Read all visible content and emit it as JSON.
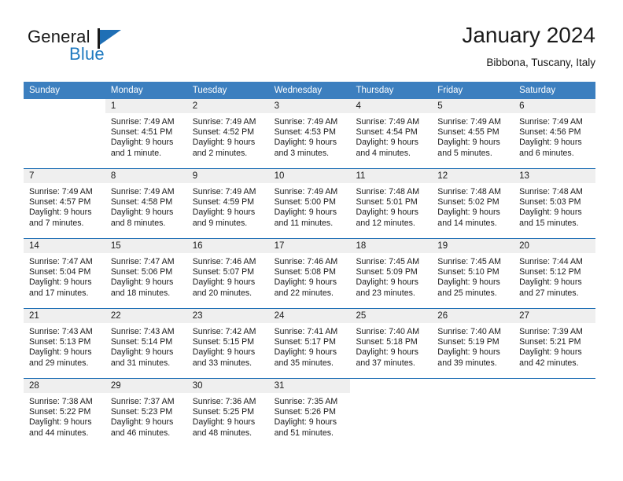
{
  "brand": {
    "name_part1": "General",
    "name_part2": "Blue"
  },
  "header": {
    "title": "January 2024",
    "location": "Bibbona, Tuscany, Italy"
  },
  "weekdays": [
    "Sunday",
    "Monday",
    "Tuesday",
    "Wednesday",
    "Thursday",
    "Friday",
    "Saturday"
  ],
  "colors": {
    "header_blue": "#3c7fbf",
    "week_rule_blue": "#1f6fb5",
    "daynum_band": "#efefef",
    "logo_blue": "#1f7ac0",
    "text": "#1a1a1a"
  },
  "weeks": [
    [
      {
        "day": "",
        "sunrise": "",
        "sunset": "",
        "daylight_line1": "",
        "daylight_line2": ""
      },
      {
        "day": "1",
        "sunrise": "Sunrise: 7:49 AM",
        "sunset": "Sunset: 4:51 PM",
        "daylight_line1": "Daylight: 9 hours",
        "daylight_line2": "and 1 minute."
      },
      {
        "day": "2",
        "sunrise": "Sunrise: 7:49 AM",
        "sunset": "Sunset: 4:52 PM",
        "daylight_line1": "Daylight: 9 hours",
        "daylight_line2": "and 2 minutes."
      },
      {
        "day": "3",
        "sunrise": "Sunrise: 7:49 AM",
        "sunset": "Sunset: 4:53 PM",
        "daylight_line1": "Daylight: 9 hours",
        "daylight_line2": "and 3 minutes."
      },
      {
        "day": "4",
        "sunrise": "Sunrise: 7:49 AM",
        "sunset": "Sunset: 4:54 PM",
        "daylight_line1": "Daylight: 9 hours",
        "daylight_line2": "and 4 minutes."
      },
      {
        "day": "5",
        "sunrise": "Sunrise: 7:49 AM",
        "sunset": "Sunset: 4:55 PM",
        "daylight_line1": "Daylight: 9 hours",
        "daylight_line2": "and 5 minutes."
      },
      {
        "day": "6",
        "sunrise": "Sunrise: 7:49 AM",
        "sunset": "Sunset: 4:56 PM",
        "daylight_line1": "Daylight: 9 hours",
        "daylight_line2": "and 6 minutes."
      }
    ],
    [
      {
        "day": "7",
        "sunrise": "Sunrise: 7:49 AM",
        "sunset": "Sunset: 4:57 PM",
        "daylight_line1": "Daylight: 9 hours",
        "daylight_line2": "and 7 minutes."
      },
      {
        "day": "8",
        "sunrise": "Sunrise: 7:49 AM",
        "sunset": "Sunset: 4:58 PM",
        "daylight_line1": "Daylight: 9 hours",
        "daylight_line2": "and 8 minutes."
      },
      {
        "day": "9",
        "sunrise": "Sunrise: 7:49 AM",
        "sunset": "Sunset: 4:59 PM",
        "daylight_line1": "Daylight: 9 hours",
        "daylight_line2": "and 9 minutes."
      },
      {
        "day": "10",
        "sunrise": "Sunrise: 7:49 AM",
        "sunset": "Sunset: 5:00 PM",
        "daylight_line1": "Daylight: 9 hours",
        "daylight_line2": "and 11 minutes."
      },
      {
        "day": "11",
        "sunrise": "Sunrise: 7:48 AM",
        "sunset": "Sunset: 5:01 PM",
        "daylight_line1": "Daylight: 9 hours",
        "daylight_line2": "and 12 minutes."
      },
      {
        "day": "12",
        "sunrise": "Sunrise: 7:48 AM",
        "sunset": "Sunset: 5:02 PM",
        "daylight_line1": "Daylight: 9 hours",
        "daylight_line2": "and 14 minutes."
      },
      {
        "day": "13",
        "sunrise": "Sunrise: 7:48 AM",
        "sunset": "Sunset: 5:03 PM",
        "daylight_line1": "Daylight: 9 hours",
        "daylight_line2": "and 15 minutes."
      }
    ],
    [
      {
        "day": "14",
        "sunrise": "Sunrise: 7:47 AM",
        "sunset": "Sunset: 5:04 PM",
        "daylight_line1": "Daylight: 9 hours",
        "daylight_line2": "and 17 minutes."
      },
      {
        "day": "15",
        "sunrise": "Sunrise: 7:47 AM",
        "sunset": "Sunset: 5:06 PM",
        "daylight_line1": "Daylight: 9 hours",
        "daylight_line2": "and 18 minutes."
      },
      {
        "day": "16",
        "sunrise": "Sunrise: 7:46 AM",
        "sunset": "Sunset: 5:07 PM",
        "daylight_line1": "Daylight: 9 hours",
        "daylight_line2": "and 20 minutes."
      },
      {
        "day": "17",
        "sunrise": "Sunrise: 7:46 AM",
        "sunset": "Sunset: 5:08 PM",
        "daylight_line1": "Daylight: 9 hours",
        "daylight_line2": "and 22 minutes."
      },
      {
        "day": "18",
        "sunrise": "Sunrise: 7:45 AM",
        "sunset": "Sunset: 5:09 PM",
        "daylight_line1": "Daylight: 9 hours",
        "daylight_line2": "and 23 minutes."
      },
      {
        "day": "19",
        "sunrise": "Sunrise: 7:45 AM",
        "sunset": "Sunset: 5:10 PM",
        "daylight_line1": "Daylight: 9 hours",
        "daylight_line2": "and 25 minutes."
      },
      {
        "day": "20",
        "sunrise": "Sunrise: 7:44 AM",
        "sunset": "Sunset: 5:12 PM",
        "daylight_line1": "Daylight: 9 hours",
        "daylight_line2": "and 27 minutes."
      }
    ],
    [
      {
        "day": "21",
        "sunrise": "Sunrise: 7:43 AM",
        "sunset": "Sunset: 5:13 PM",
        "daylight_line1": "Daylight: 9 hours",
        "daylight_line2": "and 29 minutes."
      },
      {
        "day": "22",
        "sunrise": "Sunrise: 7:43 AM",
        "sunset": "Sunset: 5:14 PM",
        "daylight_line1": "Daylight: 9 hours",
        "daylight_line2": "and 31 minutes."
      },
      {
        "day": "23",
        "sunrise": "Sunrise: 7:42 AM",
        "sunset": "Sunset: 5:15 PM",
        "daylight_line1": "Daylight: 9 hours",
        "daylight_line2": "and 33 minutes."
      },
      {
        "day": "24",
        "sunrise": "Sunrise: 7:41 AM",
        "sunset": "Sunset: 5:17 PM",
        "daylight_line1": "Daylight: 9 hours",
        "daylight_line2": "and 35 minutes."
      },
      {
        "day": "25",
        "sunrise": "Sunrise: 7:40 AM",
        "sunset": "Sunset: 5:18 PM",
        "daylight_line1": "Daylight: 9 hours",
        "daylight_line2": "and 37 minutes."
      },
      {
        "day": "26",
        "sunrise": "Sunrise: 7:40 AM",
        "sunset": "Sunset: 5:19 PM",
        "daylight_line1": "Daylight: 9 hours",
        "daylight_line2": "and 39 minutes."
      },
      {
        "day": "27",
        "sunrise": "Sunrise: 7:39 AM",
        "sunset": "Sunset: 5:21 PM",
        "daylight_line1": "Daylight: 9 hours",
        "daylight_line2": "and 42 minutes."
      }
    ],
    [
      {
        "day": "28",
        "sunrise": "Sunrise: 7:38 AM",
        "sunset": "Sunset: 5:22 PM",
        "daylight_line1": "Daylight: 9 hours",
        "daylight_line2": "and 44 minutes."
      },
      {
        "day": "29",
        "sunrise": "Sunrise: 7:37 AM",
        "sunset": "Sunset: 5:23 PM",
        "daylight_line1": "Daylight: 9 hours",
        "daylight_line2": "and 46 minutes."
      },
      {
        "day": "30",
        "sunrise": "Sunrise: 7:36 AM",
        "sunset": "Sunset: 5:25 PM",
        "daylight_line1": "Daylight: 9 hours",
        "daylight_line2": "and 48 minutes."
      },
      {
        "day": "31",
        "sunrise": "Sunrise: 7:35 AM",
        "sunset": "Sunset: 5:26 PM",
        "daylight_line1": "Daylight: 9 hours",
        "daylight_line2": "and 51 minutes."
      },
      {
        "day": "",
        "sunrise": "",
        "sunset": "",
        "daylight_line1": "",
        "daylight_line2": ""
      },
      {
        "day": "",
        "sunrise": "",
        "sunset": "",
        "daylight_line1": "",
        "daylight_line2": ""
      },
      {
        "day": "",
        "sunrise": "",
        "sunset": "",
        "daylight_line1": "",
        "daylight_line2": ""
      }
    ]
  ]
}
